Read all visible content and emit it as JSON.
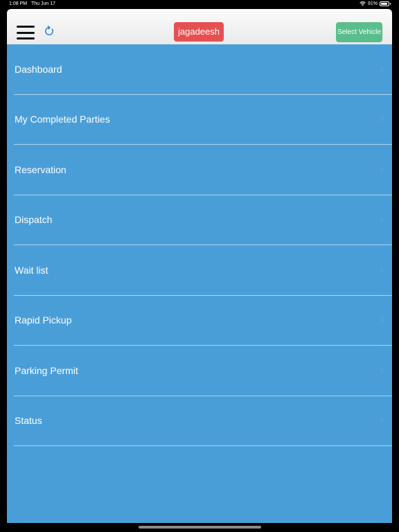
{
  "status_bar": {
    "time": "1:08 PM",
    "date": "Thu Jun 17",
    "battery_text": "91%",
    "battery_level": 0.91
  },
  "header": {
    "user_name": "jagadeesh",
    "select_vehicle_label": "Select Vehicle",
    "menu_icon": "hamburger-menu-icon",
    "refresh_icon": "refresh-icon"
  },
  "menu": {
    "items": [
      {
        "label": "Dashboard"
      },
      {
        "label": "My Completed Parties"
      },
      {
        "label": "Reservation"
      },
      {
        "label": "Dispatch"
      },
      {
        "label": "Wait list"
      },
      {
        "label": "Rapid Pickup"
      },
      {
        "label": "Parking Permit"
      },
      {
        "label": "Status"
      }
    ]
  },
  "colors": {
    "menu_bg": "#4a9ed8",
    "user_badge": "#e65050",
    "vehicle_button": "#5bbd8c",
    "refresh_icon": "#2f7fd6"
  }
}
